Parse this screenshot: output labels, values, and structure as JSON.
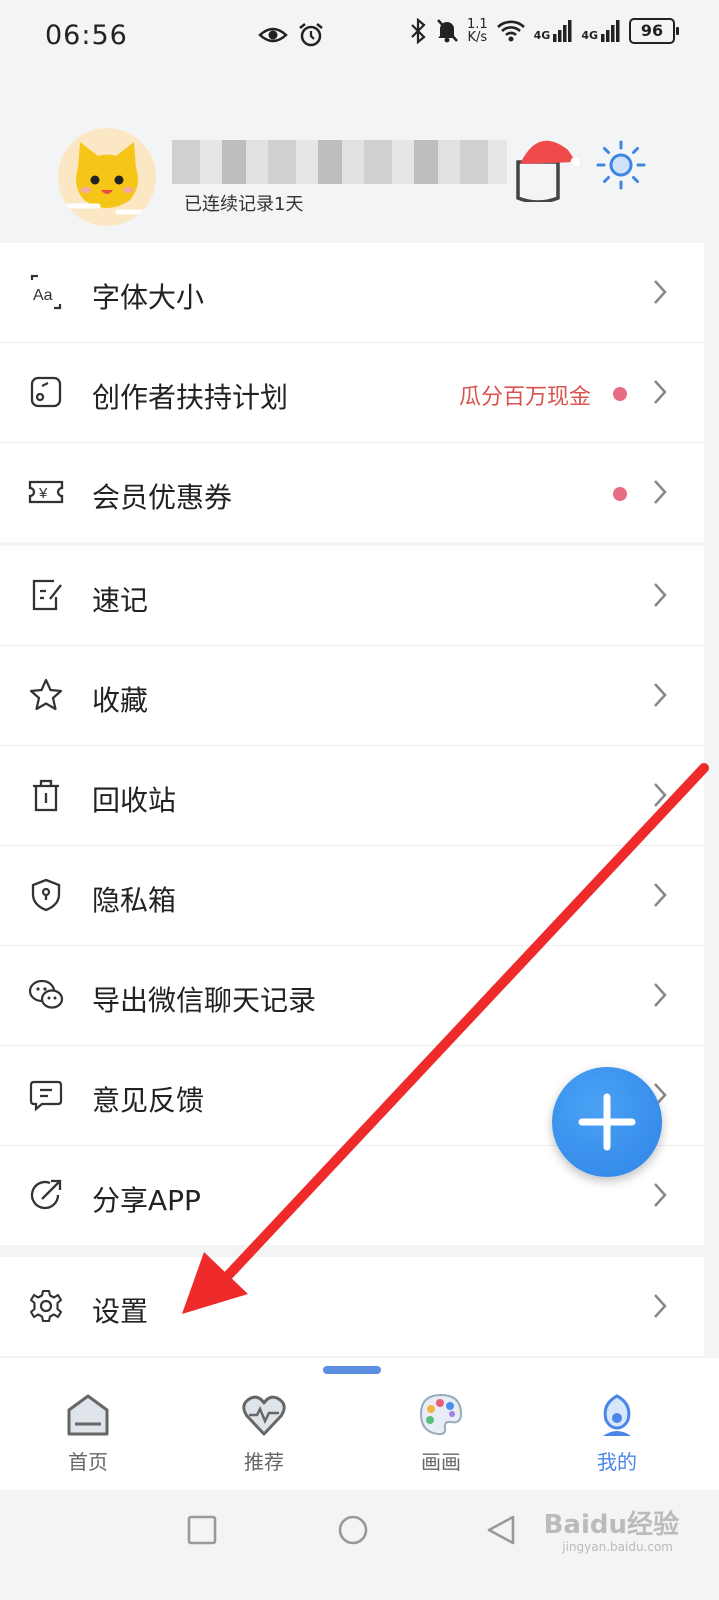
{
  "status_bar": {
    "time": "06:56",
    "net_speed_value": "1.1",
    "net_speed_unit": "K/s",
    "signal_1": "4G",
    "signal_2": "4G",
    "battery": "96"
  },
  "profile": {
    "streak_text": "已连续记录1天"
  },
  "menu_group_1": [
    {
      "label": "字体大小",
      "icon": "font-size-icon"
    },
    {
      "label": "创作者扶持计划",
      "icon": "creator-icon",
      "promo": "瓜分百万现金",
      "dot": true
    },
    {
      "label": "会员优惠券",
      "icon": "coupon-icon",
      "dot": true
    }
  ],
  "menu_group_2": [
    {
      "label": "速记",
      "icon": "quick-note-icon"
    },
    {
      "label": "收藏",
      "icon": "star-icon"
    },
    {
      "label": "回收站",
      "icon": "trash-icon"
    },
    {
      "label": "隐私箱",
      "icon": "shield-icon"
    },
    {
      "label": "导出微信聊天记录",
      "icon": "wechat-icon"
    },
    {
      "label": "意见反馈",
      "icon": "feedback-icon"
    },
    {
      "label": "分享APP",
      "icon": "share-icon"
    }
  ],
  "menu_group_3": [
    {
      "label": "设置",
      "icon": "gear-icon"
    }
  ],
  "tabs": [
    {
      "label": "首页",
      "icon": "home-icon"
    },
    {
      "label": "推荐",
      "icon": "heart-pulse-icon"
    },
    {
      "label": "画画",
      "icon": "palette-icon"
    },
    {
      "label": "我的",
      "icon": "profile-icon",
      "active": true
    }
  ],
  "watermark": {
    "brand": "Baidu经验",
    "url": "jingyan.baidu.com"
  },
  "colors": {
    "accent": "#4a86e8",
    "promo": "#d9534f",
    "dot": "#e76c84",
    "fab": "#2f84e6",
    "arrow": "#ee2a2a"
  }
}
